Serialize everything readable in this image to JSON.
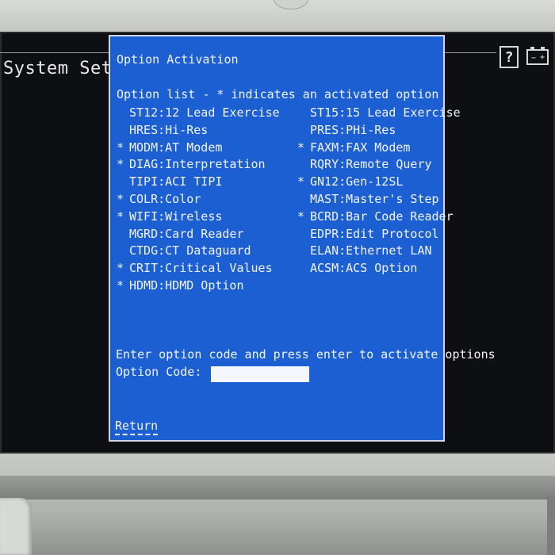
{
  "screen": {
    "title": "System Setup",
    "help_icon_label": "?",
    "battery_minus": "−",
    "battery_plus": "+"
  },
  "dialog": {
    "title": "Option Activation",
    "subtitle": "Option list - * indicates an activated option",
    "options_left": [
      {
        "mark": "",
        "text": "ST12:12 Lead Exercise"
      },
      {
        "mark": "",
        "text": "HRES:Hi-Res"
      },
      {
        "mark": "*",
        "text": "MODM:AT Modem"
      },
      {
        "mark": "*",
        "text": "DIAG:Interpretation"
      },
      {
        "mark": "",
        "text": "TIPI:ACI TIPI"
      },
      {
        "mark": "*",
        "text": "COLR:Color"
      },
      {
        "mark": "*",
        "text": "WIFI:Wireless"
      },
      {
        "mark": "",
        "text": "MGRD:Card Reader"
      },
      {
        "mark": "",
        "text": "CTDG:CT Dataguard"
      },
      {
        "mark": "*",
        "text": "CRIT:Critical Values"
      },
      {
        "mark": "*",
        "text": "HDMD:HDMD Option"
      }
    ],
    "options_right": [
      {
        "mark": "",
        "text": "ST15:15 Lead Exercise"
      },
      {
        "mark": "",
        "text": "PRES:PHi-Res"
      },
      {
        "mark": "*",
        "text": "FAXM:FAX Modem"
      },
      {
        "mark": "",
        "text": "RQRY:Remote Query"
      },
      {
        "mark": "*",
        "text": "GN12:Gen-12SL"
      },
      {
        "mark": "",
        "text": "MAST:Master's Step"
      },
      {
        "mark": "*",
        "text": "BCRD:Bar Code Reader"
      },
      {
        "mark": "",
        "text": "EDPR:Edit Protocol"
      },
      {
        "mark": "",
        "text": "ELAN:Ethernet LAN"
      },
      {
        "mark": "",
        "text": "ACSM:ACS Option"
      }
    ],
    "instruction": "Enter option code and press enter to activate options",
    "code_label": "Option Code:",
    "code_value": "",
    "return_label": "Return"
  },
  "colors": {
    "dialog_bg": "#1b5fd3",
    "screen_bg": "#0d0f12"
  }
}
